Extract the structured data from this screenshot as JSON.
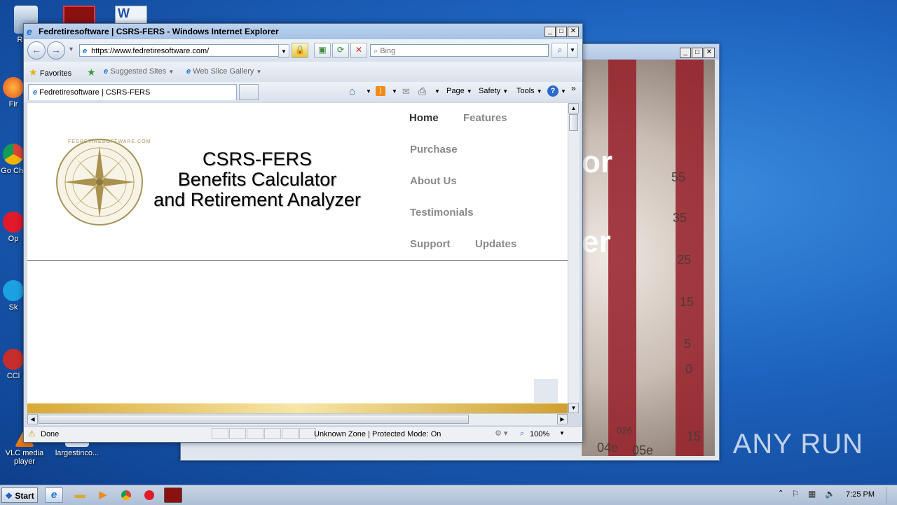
{
  "desktop": {
    "icons": [
      {
        "label": "Recy",
        "icon": "recycle-bin-icon"
      },
      {
        "label": "Fir",
        "icon": "firefox-icon"
      },
      {
        "label": "Go Chr",
        "icon": "chrome-icon"
      },
      {
        "label": "Op",
        "icon": "opera-icon"
      },
      {
        "label": "Sk",
        "icon": "skype-icon"
      },
      {
        "label": "CCl",
        "icon": "ccleaner-icon"
      },
      {
        "label": "VLC media player",
        "icon": "vlc-icon"
      },
      {
        "label": "largestinco...",
        "icon": "file-icon"
      }
    ],
    "watermark": "ANY RUN"
  },
  "back_window": {
    "photo_text": [
      "or",
      "er"
    ],
    "photo_numbers": [
      "55",
      "35",
      "25",
      "15",
      "5",
      "0",
      "15",
      "04e",
      "05e",
      "026"
    ]
  },
  "ie": {
    "title": "Fedretiresoftware | CSRS-FERS - Windows Internet Explorer",
    "address": "https://www.fedretiresoftware.com/",
    "search_placeholder": "Bing",
    "favorites_label": "Favorites",
    "suggested_sites": "Suggested Sites",
    "web_slice": "Web Slice Gallery",
    "tab_title": "Fedretiresoftware | CSRS-FERS",
    "commands": {
      "page": "Page",
      "safety": "Safety",
      "tools": "Tools"
    },
    "more": "»",
    "status_done": "Done",
    "status_zone": "Unknown Zone | Protected Mode: On",
    "zoom": "100%"
  },
  "site": {
    "title_line1": "CSRS-FERS",
    "title_line2": "Benefits Calculator",
    "title_line3": "and Retirement Analyzer",
    "seal_text": "FEDRETIRESOFTWARE.COM",
    "nav": {
      "home": "Home",
      "features": "Features",
      "purchase": "Purchase",
      "about": "About Us",
      "testimonials": "Testimonials",
      "support": "Support",
      "updates": "Updates"
    }
  },
  "taskbar": {
    "start": "Start",
    "clock": "7:25 PM"
  },
  "colors": {
    "nav_inactive": "#8a8a8a",
    "nav_active": "#333333",
    "ie_title": "#a8c3e6",
    "gold": "#d8a935"
  }
}
